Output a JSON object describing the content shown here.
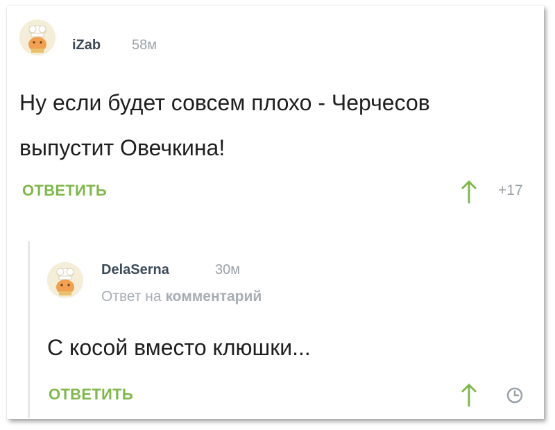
{
  "comment": {
    "username": "iZab",
    "time": "58м",
    "text_line1": "Ну если будет совсем плохо - Черчесов",
    "text_line2": "выпустит Овечкина!",
    "reply_label": "ОТВЕТИТЬ",
    "rating": "+17"
  },
  "reply": {
    "username": "DelaSerna",
    "time": "30м",
    "reply_to_prefix": "Ответ на",
    "reply_to_link": "комментарий",
    "text": "С косой вместо клюшки...",
    "reply_label": "ОТВЕТИТЬ"
  },
  "colors": {
    "accent_green": "#7fb84a",
    "muted_gray": "#9aa1a8",
    "username": "#3b4a5a"
  },
  "icons": {
    "avatar": "chef-hat-avatar",
    "upvote": "arrow-up-icon",
    "time": "clock-icon"
  }
}
